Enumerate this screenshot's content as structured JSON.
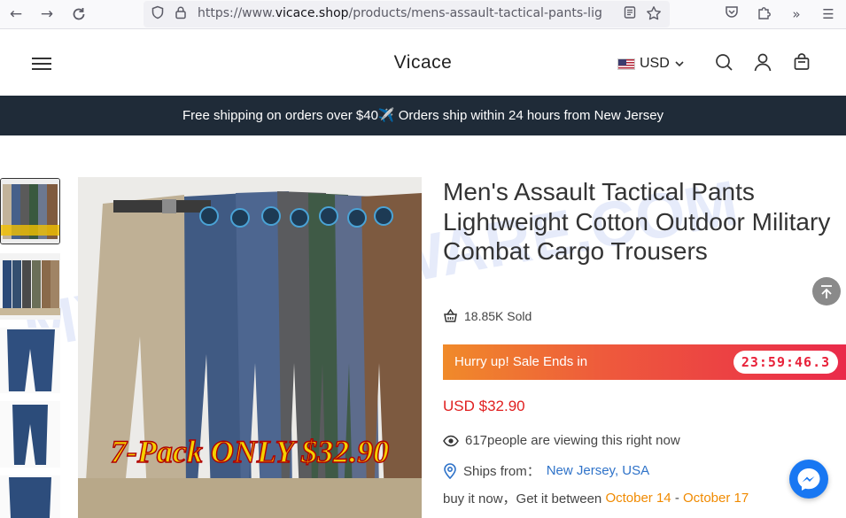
{
  "browser": {
    "url_prefix": "https://www.",
    "url_domain": "vicace.shop",
    "url_path": "/products/mens-assault-tactical-pants-lig"
  },
  "header": {
    "brand": "Vicace",
    "currency": "USD"
  },
  "announcement": {
    "text": "Free shipping on orders over $40✈️ Orders ship within 24 hours from New Jersey"
  },
  "gallery": {
    "promo_text": "7-Pack ONLY $32.90",
    "thumb_promo_text": "7-Pack ONLY $32.90"
  },
  "product": {
    "title": "Men's Assault Tactical Pants Lightweight Cotton Outdoor Military Combat Cargo Trousers",
    "sold": "18.85K Sold",
    "sale_label": "Hurry up! Sale Ends in",
    "countdown": "23:59:46.3",
    "price": "USD $32.90",
    "viewers": "617people are viewing this right now",
    "ships_label": "Ships from：",
    "ships_location": "New Jersey, USA",
    "delivery_prefix": "buy it now，Get it between",
    "delivery_start": "October 14",
    "delivery_sep": " - ",
    "delivery_end": "October 17"
  },
  "watermark": "MYANTISPYWARE.COM"
}
